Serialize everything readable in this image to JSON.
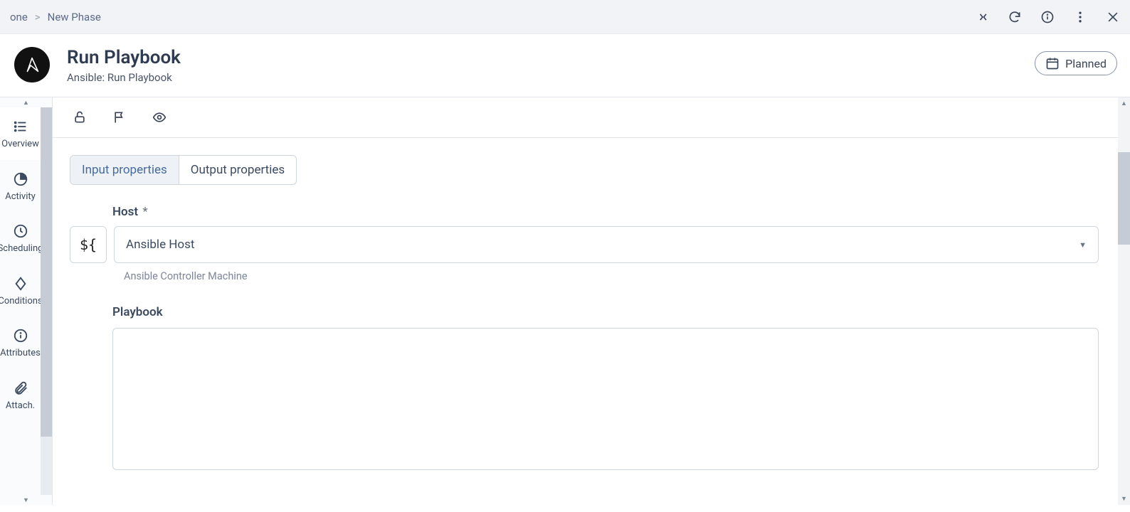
{
  "breadcrumb": {
    "item1": "one",
    "sep": ">",
    "item2": "New Phase"
  },
  "topIcons": {
    "collapse": "collapse-icon",
    "refresh": "refresh-icon",
    "info": "info-icon",
    "more": "more-icon",
    "close": "close-icon"
  },
  "header": {
    "title": "Run Playbook",
    "subtitle": "Ansible: Run Playbook",
    "status": "Planned"
  },
  "sidebar": {
    "items": [
      {
        "key": "overview",
        "label": "Overview",
        "icon": "list-icon"
      },
      {
        "key": "activity",
        "label": "Activity",
        "icon": "pie-icon"
      },
      {
        "key": "scheduling",
        "label": "Scheduling",
        "icon": "clock-icon"
      },
      {
        "key": "conditions",
        "label": "Conditions",
        "icon": "diamond-icon"
      },
      {
        "key": "attributes",
        "label": "Attributes",
        "icon": "info-icon"
      },
      {
        "key": "attachments",
        "label": "Attach.",
        "icon": "paperclip-icon"
      }
    ]
  },
  "toolbar": {
    "lock": "unlock-icon",
    "flag": "flag-icon",
    "eye": "eye-icon"
  },
  "tabs": {
    "input": "Input properties",
    "output": "Output properties"
  },
  "form": {
    "host": {
      "label": "Host",
      "required": "*",
      "value": "Ansible Host",
      "hint": "Ansible Controller Machine",
      "varToken": "${"
    },
    "playbook": {
      "label": "Playbook",
      "value": ""
    }
  }
}
